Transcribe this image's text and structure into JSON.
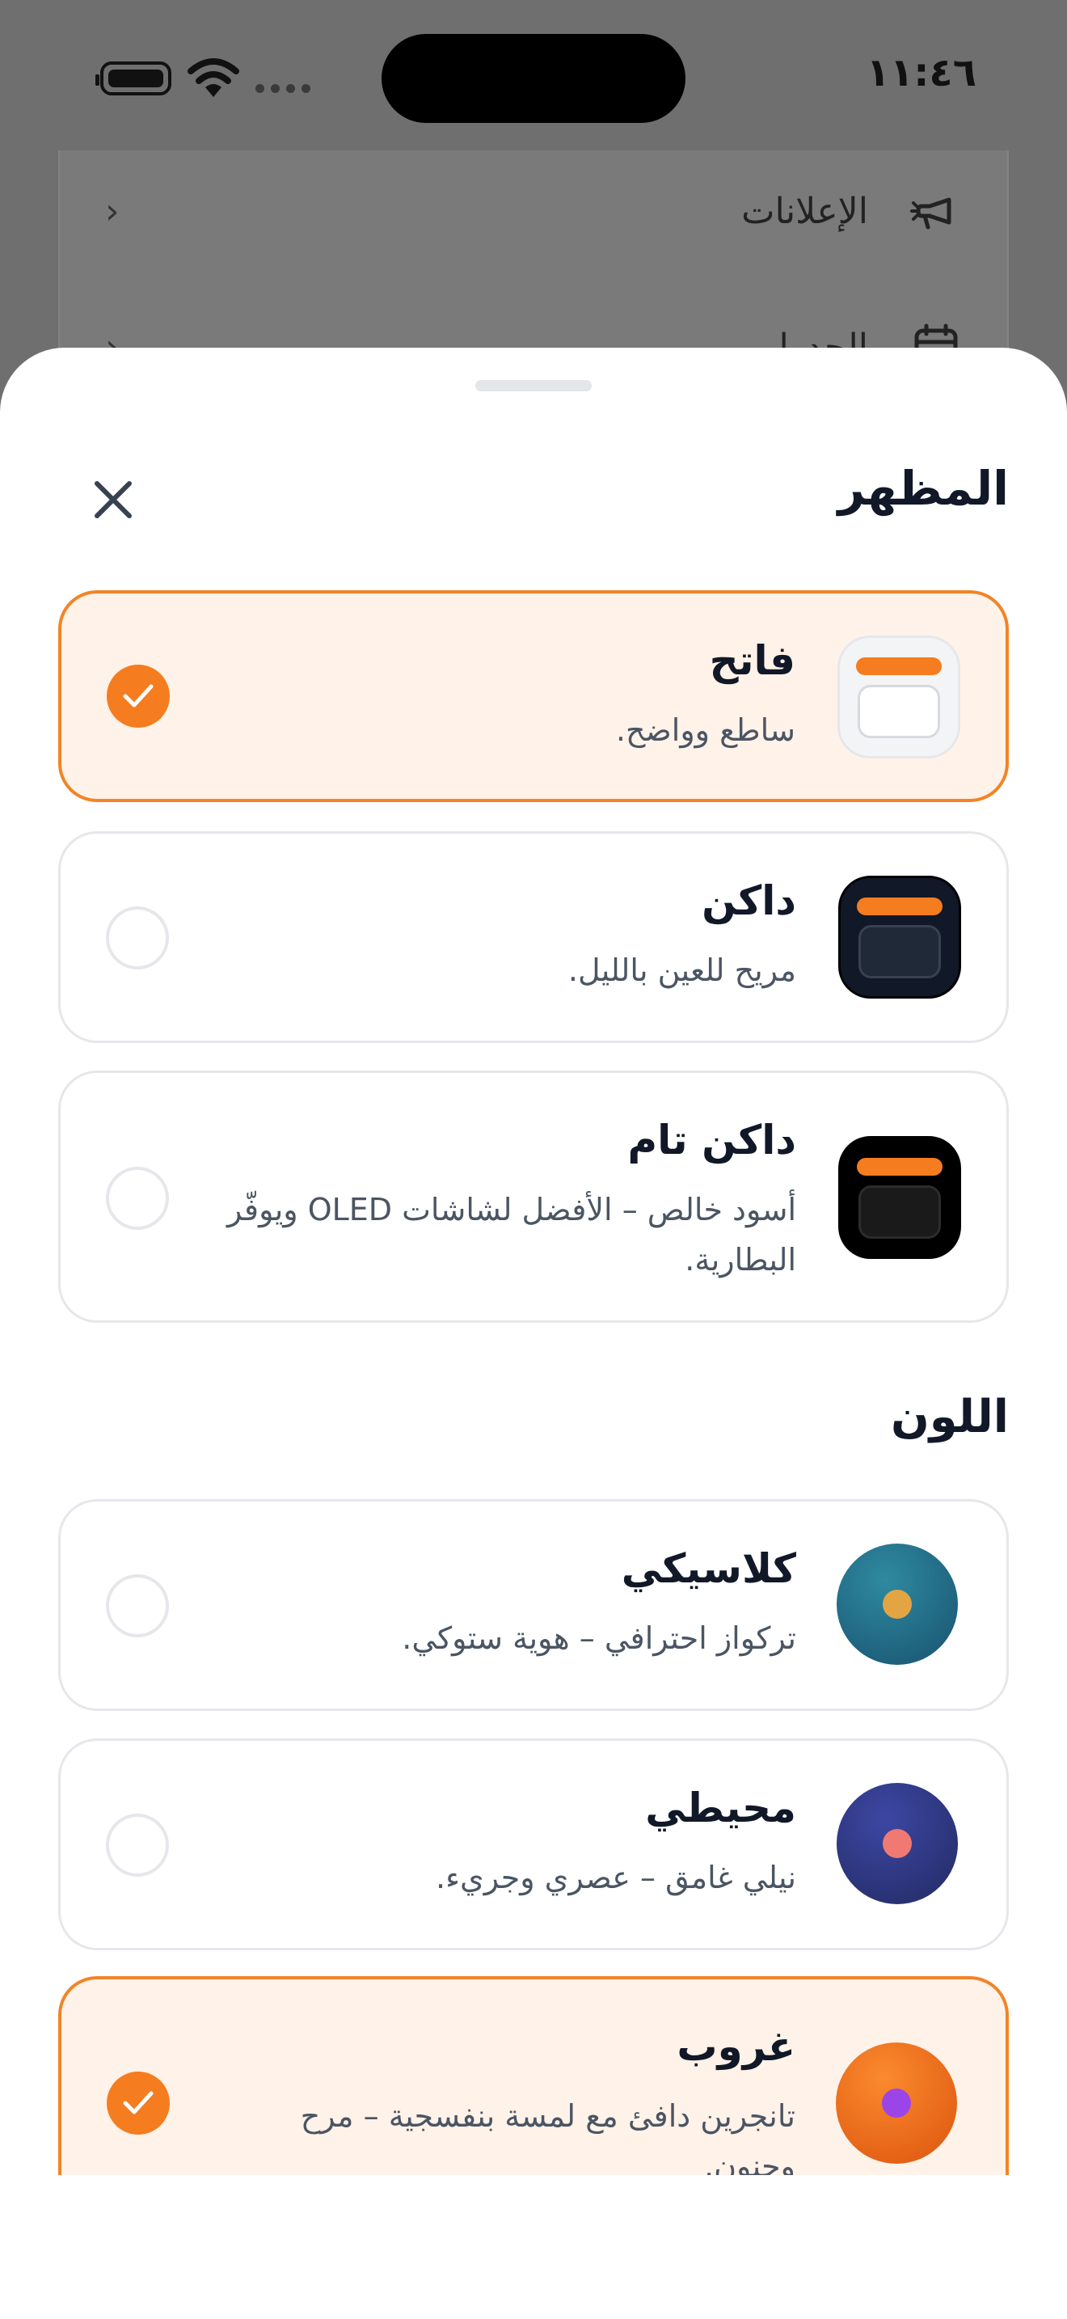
{
  "status_bar": {
    "time": "١١:٤٦"
  },
  "background": {
    "rows": [
      {
        "label": "الإعلانات",
        "icon": "megaphone-icon"
      },
      {
        "label": "الجدول",
        "icon": "calendar-icon"
      }
    ]
  },
  "sheet": {
    "appearance_title": "المظهر",
    "color_title": "اللون",
    "appearance_options": [
      {
        "title": "فاتح",
        "desc": "ساطع وواضح.",
        "selected": true
      },
      {
        "title": "داكن",
        "desc": "مريح للعين بالليل.",
        "selected": false
      },
      {
        "title": "داكن تام",
        "desc": "أسود خالص – الأفضل لشاشات OLED ويوفّر البطارية.",
        "selected": false
      }
    ],
    "color_options": [
      {
        "title": "كلاسيكي",
        "desc": "تركواز احترافي – هوية ستوكي.",
        "selected": false,
        "color": "#1f6f86",
        "dot": "#e3a543"
      },
      {
        "title": "محيطي",
        "desc": "نيلي غامق – عصري وجريء.",
        "selected": false,
        "color": "#2e3789",
        "dot": "#f07a73"
      },
      {
        "title": "غروب",
        "desc": "تانجرين دافئ مع لمسة بنفسجية – مرح وحنون.",
        "selected": true,
        "color": "#f26d1c",
        "dot": "#9b45e8"
      }
    ],
    "accent_color": "#f57c1f"
  }
}
